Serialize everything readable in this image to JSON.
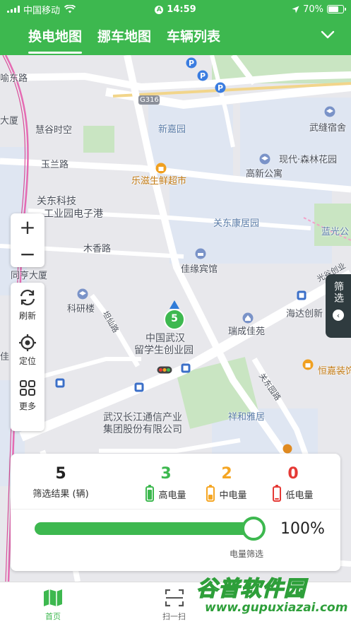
{
  "status_bar": {
    "carrier": "中国移动",
    "time": "14:59",
    "battery": "70%",
    "battery_level": 0.7,
    "location_badge": "A"
  },
  "nav": {
    "tabs": [
      {
        "label": "换电地图",
        "active": true
      },
      {
        "label": "挪车地图",
        "active": false
      },
      {
        "label": "车辆列表",
        "active": false
      }
    ]
  },
  "map": {
    "labels": {
      "yudong_rd": "喻东路",
      "g316": "G316",
      "xinjiayuan": "新嘉园",
      "wuqiang_sushe": "武缝宿舍",
      "dasha": "大厦",
      "huigu": "慧谷时空",
      "yulan_rd": "玉兰路",
      "lezisheng": "乐滋生鲜超市",
      "xiandai": "现代·森林花园",
      "gaoxin": "高新公寓",
      "guandong_keji": "关东科技",
      "gongyeyuan": "工业园电子港",
      "guandong_kangju": "关东康居园",
      "languang": "蓝光公",
      "muxiang_rd": "木香路",
      "jiayuan": "佳缘宾馆",
      "tongheng": "同亨大厦",
      "guangu": "光谷创业",
      "keyan": "科研楼",
      "tanxian_rd": "坦仙路",
      "haida": "海达创新",
      "ruicheng": "瑞成佳苑",
      "china_wuhan": "中国武汉",
      "liuxuesheng": "留学生创业园",
      "hengjia": "恒嘉装饰",
      "guandong_yuan_rd": "关东园路",
      "wuhan_changjiang": "武汉长江通信产业",
      "jituan": "集团股份有限公司",
      "xianghe": "祥和雅居",
      "jia": "佳"
    },
    "marker_count": "5",
    "icons": [
      "parking-icon",
      "hotel-icon",
      "shopping-bag-icon",
      "school-icon",
      "metro-icon",
      "traffic-light-icon"
    ]
  },
  "controls": {
    "zoom_in": "+",
    "zoom_out": "−",
    "refresh": "刷新",
    "locate": "定位",
    "more": "更多",
    "filter": "筛选"
  },
  "panel": {
    "total": "5",
    "total_label": "筛选结果 (辆)",
    "high": {
      "count": "3",
      "label": "高电量",
      "color": "#3db84f",
      "level": 0.85
    },
    "mid": {
      "count": "2",
      "label": "中电量",
      "color": "#f5a623",
      "level": 0.45
    },
    "low": {
      "count": "0",
      "label": "低电量",
      "color": "#e53935",
      "level": 0.12
    },
    "slider_value": 1.0,
    "slider_pct": "100%",
    "slider_label": "电量筛选"
  },
  "tabbar": {
    "home": "首页",
    "scan": "扫一扫"
  },
  "watermark": {
    "title": "谷普软件园",
    "url": "www.gupuxiazai.com"
  },
  "colors": {
    "brand": "#3db84f",
    "filter_tab": "#2f3b3f"
  }
}
